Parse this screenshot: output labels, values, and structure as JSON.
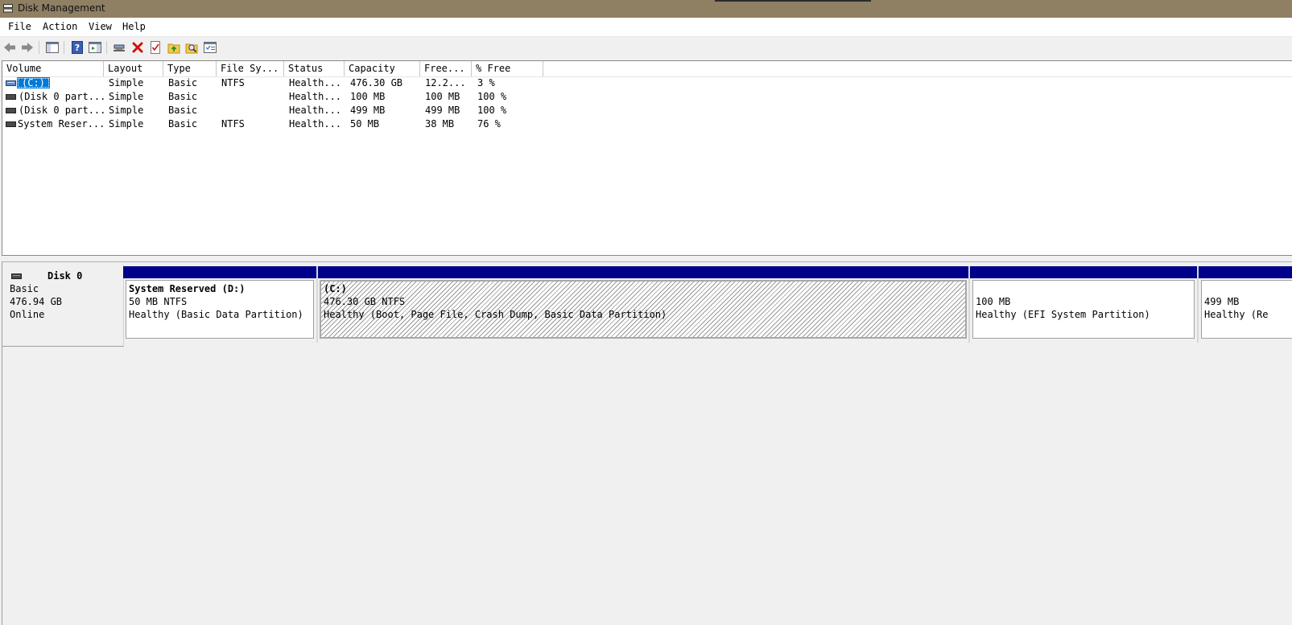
{
  "window": {
    "title": "Disk Management"
  },
  "menu": [
    "File",
    "Action",
    "View",
    "Help"
  ],
  "toolbar": {
    "icons": [
      "back-arrow-icon",
      "forward-arrow-icon",
      "console-tree-icon",
      "help-icon",
      "action-pane-icon",
      "connect-disk-icon",
      "delete-icon",
      "properties-icon",
      "open-icon",
      "explore-icon",
      "rescan-disks-icon"
    ]
  },
  "volume_list": {
    "columns": [
      "Volume",
      "Layout",
      "Type",
      "File Sy...",
      "Status",
      "Capacity",
      "Free...",
      "% Free"
    ],
    "rows": [
      {
        "volume": "(C:)",
        "layout": "Simple",
        "type": "Basic",
        "fs": "NTFS",
        "status": "Health...",
        "capacity": "476.30 GB",
        "free": "12.2...",
        "pct": "3 %"
      },
      {
        "volume": "(Disk 0 part...",
        "layout": "Simple",
        "type": "Basic",
        "fs": "",
        "status": "Health...",
        "capacity": "100 MB",
        "free": "100 MB",
        "pct": "100 %"
      },
      {
        "volume": "(Disk 0 part...",
        "layout": "Simple",
        "type": "Basic",
        "fs": "",
        "status": "Health...",
        "capacity": "499 MB",
        "free": "499 MB",
        "pct": "100 %"
      },
      {
        "volume": "System Reser...",
        "layout": "Simple",
        "type": "Basic",
        "fs": "NTFS",
        "status": "Health...",
        "capacity": "50 MB",
        "free": "38 MB",
        "pct": "76 %"
      }
    ]
  },
  "disk": {
    "name": "Disk 0",
    "type": "Basic",
    "size": "476.94 GB",
    "state": "Online",
    "partitions": [
      {
        "title": "System Reserved  (D:)",
        "size": "50 MB NTFS",
        "status": "Healthy (Basic Data Partition)"
      },
      {
        "title": " (C:)",
        "size": "476.30 GB NTFS",
        "status": "Healthy (Boot, Page File, Crash Dump, Basic Data Partition)"
      },
      {
        "title": "",
        "size": "100 MB",
        "status": "Healthy (EFI System Partition)"
      },
      {
        "title": "",
        "size": "499 MB",
        "status": "Healthy (Re"
      }
    ]
  },
  "colors": {
    "partition_bar": "#00008b",
    "selection": "#0078d7",
    "titlebar": "#8f7f63"
  }
}
